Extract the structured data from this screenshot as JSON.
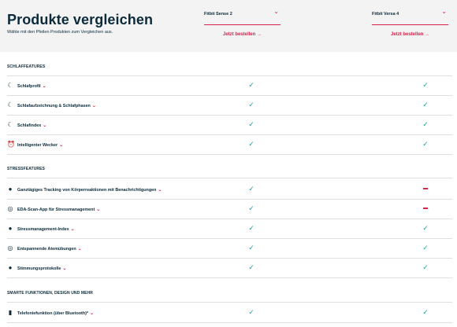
{
  "header": {
    "title": "Produkte vergleichen",
    "subtitle": "Wähle mit den Pfeilen Produkten zum Vergleichen aus."
  },
  "products": [
    {
      "name": "Fitbit Sense 2",
      "order_label": "Jetzt bestellen →"
    },
    {
      "name": "Fitbit Versa 4",
      "order_label": "Jetzt bestellen →"
    }
  ],
  "sections": [
    {
      "title": "SCHLAFFEATURES",
      "rows": [
        {
          "label": "Schlafprofil",
          "icon": "moon-icon",
          "chevron": true,
          "values": [
            "check",
            "check"
          ]
        },
        {
          "label": "Schlafaufzeichnung & Schlafphasen",
          "icon": "moon-icon",
          "chevron": true,
          "values": [
            "check",
            "check"
          ]
        },
        {
          "label": "Schlafindex",
          "icon": "moon-icon",
          "chevron": true,
          "values": [
            "check",
            "check"
          ]
        },
        {
          "label": "Intelligenter Wecker",
          "icon": "alarm-icon",
          "chevron": true,
          "values": [
            "check",
            "check"
          ]
        }
      ]
    },
    {
      "title": "STRESSFEATURES",
      "rows": [
        {
          "label": "Ganztägiges Tracking von Körperreaktionen mit Benachrichtigungen",
          "icon": "head-icon",
          "chevron": true,
          "values": [
            "check",
            "dash"
          ]
        },
        {
          "label": "EDA-Scan-App für Stressmanagement",
          "icon": "target-icon",
          "chevron": true,
          "values": [
            "check",
            "dash"
          ]
        },
        {
          "label": "Stressmanagement-Index",
          "icon": "head-icon",
          "chevron": true,
          "values": [
            "check",
            "check"
          ]
        },
        {
          "label": "Entspannende Atemübungen",
          "icon": "target-icon",
          "chevron": true,
          "values": [
            "check",
            "check"
          ]
        },
        {
          "label": "Stimmungsprotokolle",
          "icon": "head-icon",
          "chevron": true,
          "values": [
            "check",
            "check"
          ]
        }
      ]
    },
    {
      "title": "SMARTE FUNKTIONEN, DESIGN UND MEHR",
      "rows": [
        {
          "label": "Telefoniefunktion (über Bluetooth)*",
          "icon": "phone-icon",
          "chevron": true,
          "values": [
            "check",
            "check"
          ]
        }
      ]
    }
  ],
  "colors": {
    "accent": "#d9224b",
    "check": "#1a9fa0",
    "text": "#0b2a3a",
    "header_bg": "#f3f3f4"
  }
}
